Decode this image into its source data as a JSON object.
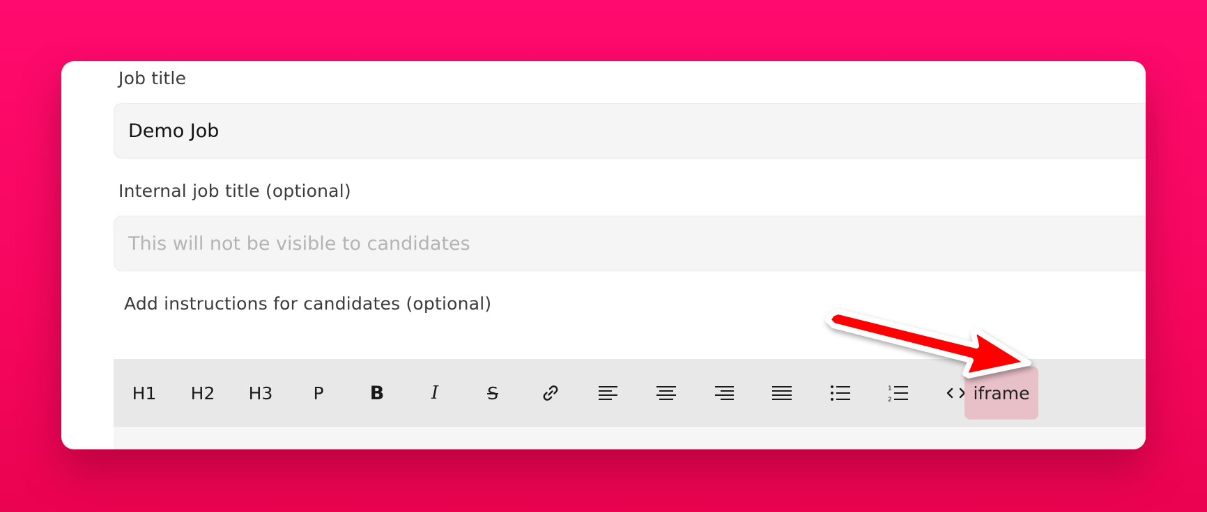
{
  "form": {
    "job_title": {
      "label": "Job title",
      "value": "Demo Job"
    },
    "internal_title": {
      "label": "Internal job title (optional)",
      "placeholder": "This will not be visible to candidates",
      "value": ""
    },
    "instructions": {
      "label": "Add instructions for candidates (optional)"
    }
  },
  "toolbar": {
    "h1": "H1",
    "h2": "H2",
    "h3": "H3",
    "p": "P",
    "bold": "B",
    "italic": "I",
    "strike": "S",
    "iframe": "iframe",
    "icons": [
      "link-icon",
      "align-left-icon",
      "align-center-icon",
      "align-right-icon",
      "align-justify-icon",
      "bullet-list-icon",
      "numbered-list-icon",
      "code-icon"
    ]
  },
  "colors": {
    "background": "#f7075f",
    "arrow": "#ff0000",
    "iframe_highlight": "#e8c0c8"
  }
}
